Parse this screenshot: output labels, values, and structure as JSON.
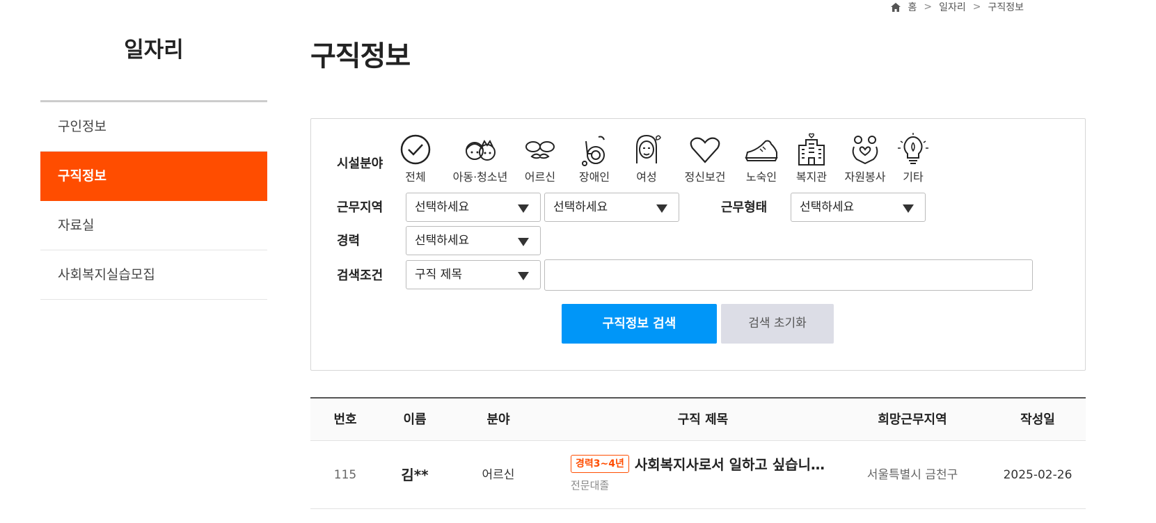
{
  "breadcrumb": {
    "home": "홈",
    "level1": "일자리",
    "level2": "구직정보"
  },
  "sidebar": {
    "title": "일자리",
    "items": [
      {
        "label": "구인정보",
        "active": false
      },
      {
        "label": "구직정보",
        "active": true
      },
      {
        "label": "자료실",
        "active": false
      },
      {
        "label": "사회복지실습모집",
        "active": false
      }
    ]
  },
  "page_title": "구직정보",
  "search": {
    "facility_label": "시설분야",
    "categories": [
      {
        "label": "전체",
        "icon": "check-circle-icon"
      },
      {
        "label": "아동·청소년",
        "icon": "children-icon"
      },
      {
        "label": "어르신",
        "icon": "glasses-mustache-icon"
      },
      {
        "label": "장애인",
        "icon": "wheelchair-icon"
      },
      {
        "label": "여성",
        "icon": "woman-icon"
      },
      {
        "label": "정신보건",
        "icon": "heart-icon"
      },
      {
        "label": "노숙인",
        "icon": "shoe-icon"
      },
      {
        "label": "복지관",
        "icon": "building-icon"
      },
      {
        "label": "자원봉사",
        "icon": "volunteer-hands-icon"
      },
      {
        "label": "기타",
        "icon": "lightbulb-icon"
      }
    ],
    "region_label": "근무지역",
    "region_select1": "선택하세요",
    "region_select2": "선택하세요",
    "work_type_label": "근무형태",
    "work_type_select": "선택하세요",
    "career_label": "경력",
    "career_select": "선택하세요",
    "condition_label": "검색조건",
    "condition_select": "구직 제목",
    "keyword_value": "",
    "search_button": "구직정보 검색",
    "reset_button": "검색 초기화"
  },
  "table": {
    "headers": [
      "번호",
      "이름",
      "분야",
      "구직 제목",
      "희망근무지역",
      "작성일"
    ],
    "rows": [
      {
        "number": "115",
        "name": "김**",
        "field": "어르신",
        "badge": "경력3~4년",
        "title": "사회복지사로서 일하고 싶습니…",
        "education": "전문대졸",
        "region": "서울특별시 금천구",
        "date": "2025-02-26"
      }
    ]
  },
  "colors": {
    "accent": "#ff4d00",
    "primary_button": "#0096f8",
    "reset_button": "#dcdde6"
  }
}
